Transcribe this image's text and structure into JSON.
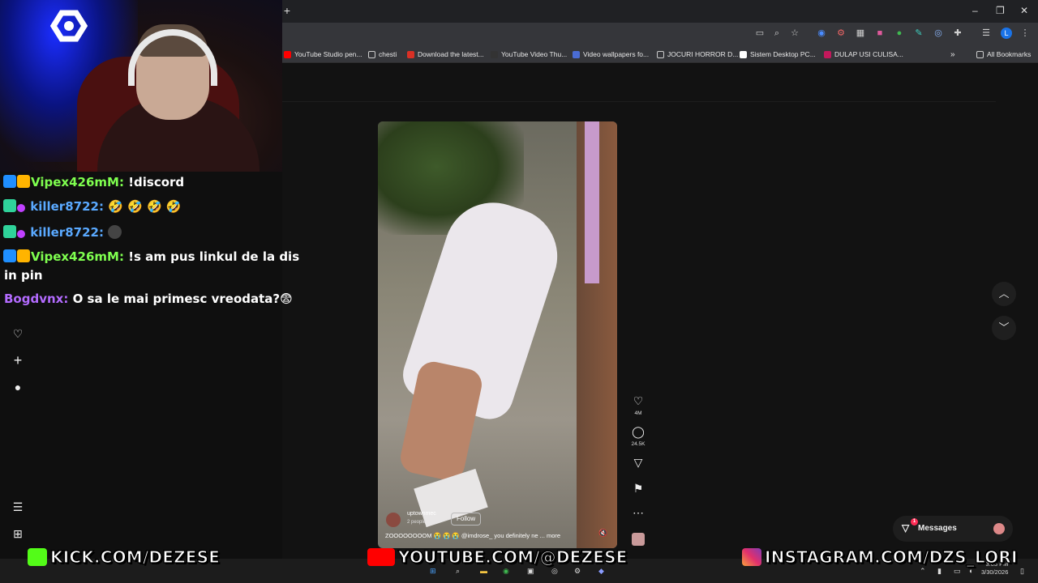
{
  "browser": {
    "new_tab": "+",
    "window_controls": [
      "–",
      "❐",
      "✕"
    ],
    "bookmarks": [
      {
        "label": "YouTube Studio pen...",
        "color": "#ff0000"
      },
      {
        "label": "chesti",
        "color": "folder"
      },
      {
        "label": "Download the latest...",
        "color": "#d93025"
      },
      {
        "label": "YouTube Video Thu...",
        "color": "#333333"
      },
      {
        "label": "Video wallpapers fo...",
        "color": "#4a6cd4"
      },
      {
        "label": "JOCURI HORROR D...",
        "color": "folder"
      },
      {
        "label": "Sistem Desktop PC...",
        "color": "#ffffff"
      },
      {
        "label": "DULAP USI CULISA...",
        "color": "#c2185b"
      }
    ],
    "more_bookmarks": "»",
    "all_bookmarks": "All Bookmarks",
    "profile_initial": "L"
  },
  "chat": {
    "messages": [
      {
        "user": "Vipex426mM:",
        "user_color": "#7fff4f",
        "text": "!discord"
      },
      {
        "user": "killer8722:",
        "user_color": "#5aa9ff",
        "text": "🤣 🤣 🤣 🤣"
      },
      {
        "user": "killer8722:",
        "user_color": "#5aa9ff",
        "text": ""
      },
      {
        "user": "Vipex426mM:",
        "user_color": "#7fff4f",
        "text": "!s am pus linkul de la dis",
        "text2": "in pin"
      },
      {
        "user": "Bogdvnx:",
        "user_color": "#b36bff",
        "text": "O sa le mai primesc vreodata?😨"
      }
    ]
  },
  "video": {
    "username": "uptownmec",
    "subtext": "2 people",
    "follow_label": "Follow",
    "caption": "ZOOOOOOOOM 😭 😭 😭 @imdrose_ you definitely ne ... more",
    "likes": "4M",
    "comments": "24.5K",
    "mute_icon": "🔇"
  },
  "messages_button": {
    "label": "Messages",
    "count": "1"
  },
  "overlays": {
    "kick": "KICK.COM/DEZESE",
    "youtube": "YOUTUBE.COM/@DEZESE",
    "instagram": "INSTAGRAM.COM/DZS_LORI"
  },
  "taskbar": {
    "time": "3:03 PM",
    "date": "3/30/2026"
  }
}
